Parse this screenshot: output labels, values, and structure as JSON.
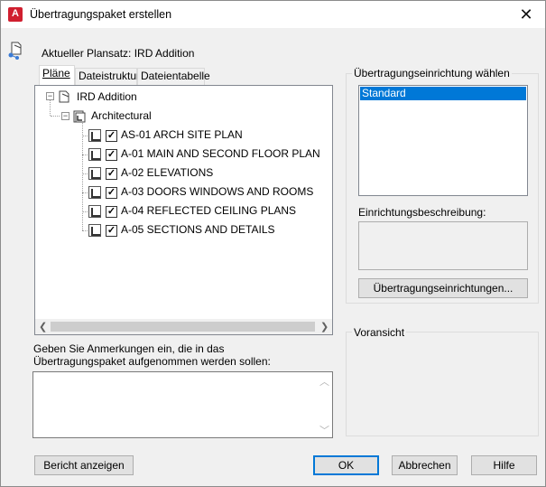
{
  "window": {
    "title": "Übertragungspaket erstellen",
    "app_icon_letter": "A"
  },
  "header": {
    "current_sheetset": "Aktueller Plansatz: IRD Addition"
  },
  "tabs": [
    {
      "label": "Pläne",
      "active": true
    },
    {
      "label": "Dateistruktur",
      "active": false
    },
    {
      "label": "Dateientabelle",
      "active": false
    }
  ],
  "tree": {
    "root": "IRD Addition",
    "subset": "Architectural",
    "sheets": [
      {
        "label": "AS-01 ARCH SITE PLAN",
        "checked": true
      },
      {
        "label": "A-01 MAIN AND SECOND FLOOR PLAN",
        "checked": true
      },
      {
        "label": "A-02 ELEVATIONS",
        "checked": true
      },
      {
        "label": "A-03 DOORS WINDOWS AND ROOMS",
        "checked": true
      },
      {
        "label": "A-04 REFLECTED CEILING PLANS",
        "checked": true
      },
      {
        "label": "A-05 SECTIONS AND DETAILS",
        "checked": true
      }
    ]
  },
  "notes": {
    "label": "Geben Sie Anmerkungen ein, die in das Übertragungspaket aufgenommen werden sollen:",
    "value": ""
  },
  "setup": {
    "label": "Übertragungseinrichtung wählen",
    "items": [
      "Standard"
    ],
    "selected": "Standard",
    "description_label": "Einrichtungsbeschreibung:",
    "description_value": "",
    "button": "Übertragungseinrichtungen..."
  },
  "preview": {
    "label": "Voransicht"
  },
  "buttons": {
    "report": "Bericht anzeigen",
    "ok": "OK",
    "cancel": "Abbrechen",
    "help": "Hilfe"
  },
  "colors": {
    "selection": "#0078d7",
    "accent_border": "#0078d7",
    "app_icon": "#d01f2f"
  }
}
